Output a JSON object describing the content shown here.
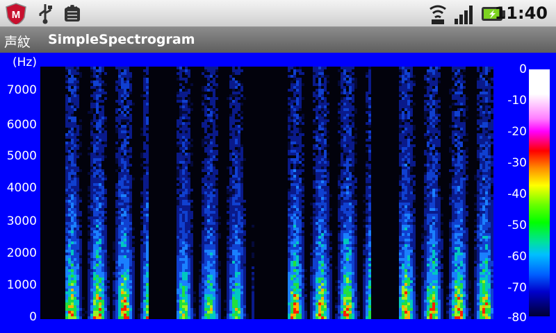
{
  "status_bar": {
    "time": "11:40",
    "icons": [
      "mcafee-shield-icon",
      "usb-icon",
      "android-debug-icon",
      "wifi-icon",
      "signal-bars-icon",
      "battery-charging-icon"
    ]
  },
  "title_bar": {
    "jp_label": "声紋",
    "app_name": "SimpleSpectrogram"
  },
  "spectrogram": {
    "y_unit": "(Hz)",
    "y_ticks": [
      "7000",
      "6000",
      "5000",
      "4000",
      "3000",
      "2000",
      "1000",
      "0"
    ],
    "colorbar_ticks": [
      "0",
      "-10",
      "-20",
      "-30",
      "-40",
      "-50",
      "-60",
      "-70",
      "-80"
    ],
    "colors": {
      "panel_bg": "#0000ff",
      "plot_bg": "#02020c"
    }
  }
}
